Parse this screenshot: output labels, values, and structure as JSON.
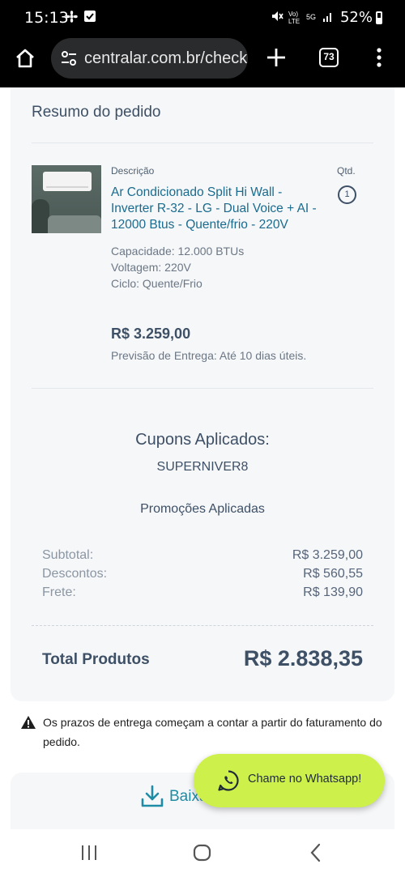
{
  "status_bar": {
    "time": "15:13",
    "battery": "52%"
  },
  "browser": {
    "url": "centralar.com.br/checkout",
    "tab_count": "73"
  },
  "order_summary": {
    "title": "Resumo do pedido",
    "description_label": "Descrição",
    "quantity_label": "Qtd.",
    "product": {
      "name": "Ar Condicionado Split Hi Wall - Inverter R-32 - LG - Dual Voice + AI - 12000 Btus - Quente/frio - 220V",
      "quantity": "1",
      "specs": [
        "Capacidade:  12.000 BTUs",
        "Voltagem:  220V",
        "Ciclo:  Quente/Frio"
      ],
      "price": "R$ 3.259,00",
      "delivery": "Previsão de Entrega: Até 10 dias úteis."
    },
    "coupons_title": "Cupons Aplicados:",
    "coupon_code": "SUPERNIVER8",
    "promotions_title": "Promoções Aplicadas",
    "summary": [
      {
        "label": "Subtotal:",
        "value": "R$ 3.259,00"
      },
      {
        "label": "Descontos:",
        "value": "R$ 560,55"
      },
      {
        "label": "Frete:",
        "value": "R$ 139,90"
      }
    ],
    "total_label": "Total Produtos",
    "total_value": "R$ 2.838,35"
  },
  "notice": {
    "text": "Os prazos de entrega começam a contar a partir do faturamento do pedido."
  },
  "download": {
    "label": "Baixar"
  },
  "whatsapp": {
    "label": "Chame no Whatsapp!"
  },
  "colors": {
    "accent_teal": "#1f8ca6",
    "product_link": "#1a6b8e",
    "whatsapp_bg": "#cdf04a",
    "heading": "#3e5066"
  },
  "icons": [
    "home-icon",
    "site-settings-icon",
    "new-tab-plus-icon",
    "tabs-icon",
    "more-menu-icon",
    "warning-icon",
    "download-icon",
    "whatsapp-icon",
    "recents-icon",
    "home-nav-icon",
    "back-icon"
  ]
}
